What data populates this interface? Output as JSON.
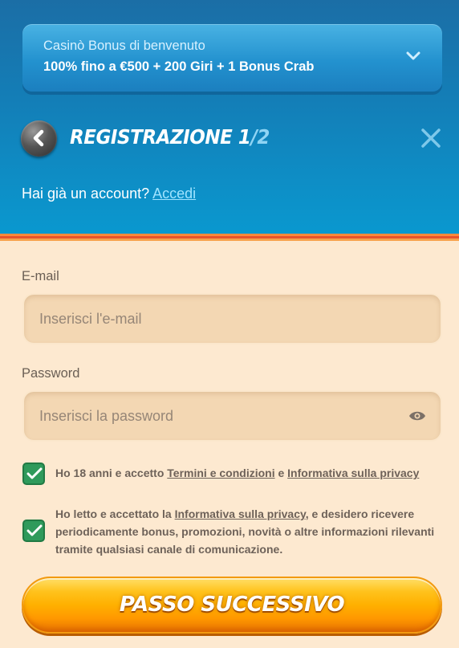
{
  "bonus": {
    "title": "Casinò Bonus di benvenuto",
    "offer": "100% fino a €500 + 200 Giri + 1 Bonus Crab"
  },
  "registration": {
    "title": "REGISTRAZIONE 1",
    "step": "/2",
    "login_prompt": "Hai già un account?",
    "login_link": "Accedi"
  },
  "form": {
    "email_label": "E-mail",
    "email_placeholder": "Inserisci l'e-mail",
    "password_label": "Password",
    "password_placeholder": "Inserisci la password"
  },
  "consents": [
    {
      "checked": true,
      "text_before": "Ho 18 anni e accetto ",
      "link1": "Termini e condizioni",
      "text_middle": " e ",
      "link2": "Informativa sulla privacy"
    },
    {
      "checked": true,
      "text_before": "Ho letto e accettato la ",
      "link1": "Informativa sulla privacy",
      "text_after": ", e desidero ricevere periodicamente bonus, promozioni, novità o altre informazioni rilevanti tramite qualsiasi canale di comunicazione."
    }
  ],
  "next_button": "PASSO SUCCESSIVO",
  "colors": {
    "header_blue": "#137fb8",
    "accent_light_blue": "#9fe3ff",
    "background": "#fde9d0",
    "checkbox_green": "#2f9a5b",
    "button_orange": "#ffb000"
  },
  "icons": [
    "chevron-down-icon",
    "back-arrow-icon",
    "close-icon",
    "eye-icon",
    "checkmark-icon"
  ]
}
